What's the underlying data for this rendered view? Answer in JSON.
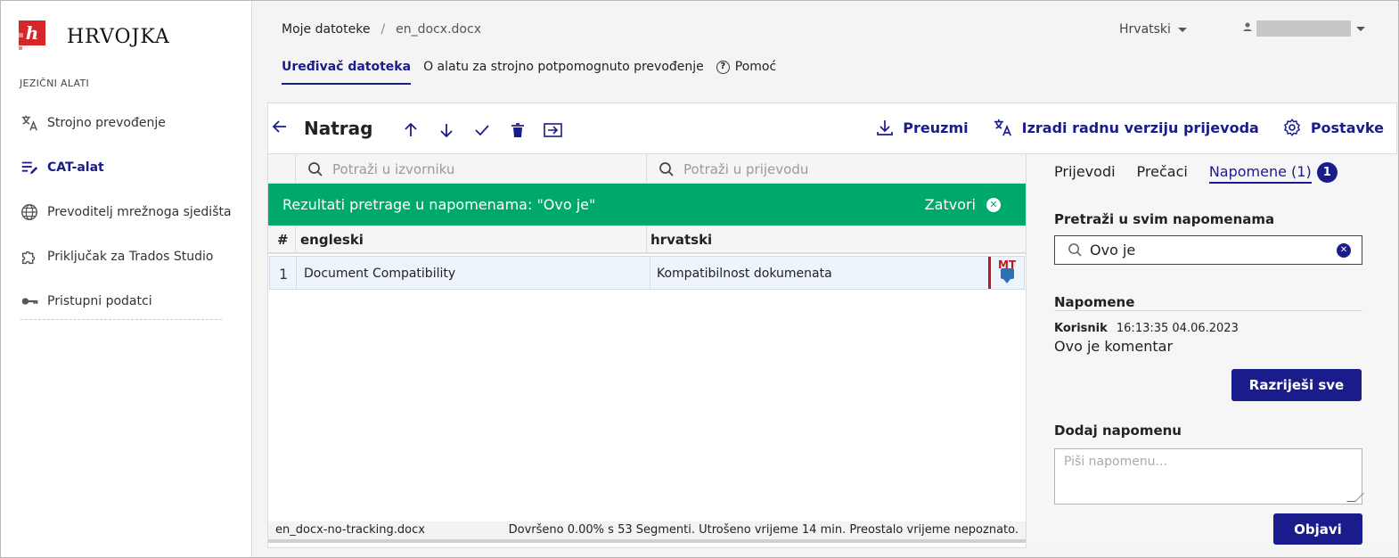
{
  "brand": {
    "name": "HRVOJKA",
    "mark_letter": "h",
    "accent": "#d4262b"
  },
  "sidebar": {
    "section": "JEZIČNI ALATI",
    "items": [
      {
        "label": "Strojno prevođenje",
        "icon": "translate-icon",
        "active": false
      },
      {
        "label": "CAT-alat",
        "icon": "edit-list-icon",
        "active": true
      },
      {
        "label": "Prevoditelj mrežnoga sjedišta",
        "icon": "globe-icon",
        "active": false
      },
      {
        "label": "Priključak za Trados Studio",
        "icon": "puzzle-icon",
        "active": false
      },
      {
        "label": "Pristupni podatci",
        "icon": "key-icon",
        "active": false
      }
    ]
  },
  "header": {
    "breadcrumb": {
      "root": "Moje datoteke",
      "separator": "/",
      "current": "en_docx.docx"
    },
    "language": "Hrvatski",
    "tabs": [
      {
        "label": "Uređivač datoteka",
        "active": true
      },
      {
        "label": "O alatu za strojno potpomognuto prevođenje",
        "active": false
      },
      {
        "label": "Pomoć",
        "active": false
      }
    ]
  },
  "toolbar": {
    "back_label": "Natrag",
    "icons": [
      "arrow-up-icon",
      "arrow-down-icon",
      "check-icon",
      "trash-icon",
      "export-icon"
    ],
    "download_label": "Preuzmi",
    "draft_label": "Izradi radnu verziju prijevoda",
    "settings_label": "Postavke"
  },
  "grid": {
    "source_search_placeholder": "Potraži u izvorniku",
    "target_search_placeholder": "Potraži u prijevodu",
    "banner_text": "Rezultati pretrage u napomenama: \"Ovo je\"",
    "banner_close": "Zatvori",
    "col_num": "#",
    "col_source": "engleski",
    "col_target": "hrvatski",
    "rows": [
      {
        "num": "1",
        "source": "Document Compatibility",
        "target": "Kompatibilnost dokumenata",
        "badge": "MT"
      }
    ],
    "status_file": "en_docx-no-tracking.docx",
    "status_progress": "Dovršeno 0.00% s 53 Segmenti. Utrošeno vrijeme 14 min. Preostalo vrijeme nepoznato."
  },
  "panel": {
    "tabs": [
      {
        "label": "Prijevodi",
        "active": false
      },
      {
        "label": "Prečaci",
        "active": false
      },
      {
        "label": "Napomene (1)",
        "active": true
      }
    ],
    "notes_badge": "1",
    "search_heading": "Pretraži u svim napomenama",
    "search_value": "Ovo je",
    "notes_heading": "Napomene",
    "note": {
      "author": "Korisnik",
      "timestamp": "16:13:35 04.06.2023",
      "text": "Ovo je komentar"
    },
    "resolve_all_label": "Razriješi sve",
    "add_note_heading": "Dodaj napomenu",
    "add_note_placeholder": "Piši napomenu...",
    "publish_label": "Objavi"
  },
  "colors": {
    "primary": "#1b1c8c",
    "banner": "#00a86b",
    "mt_red": "#c4161c"
  }
}
